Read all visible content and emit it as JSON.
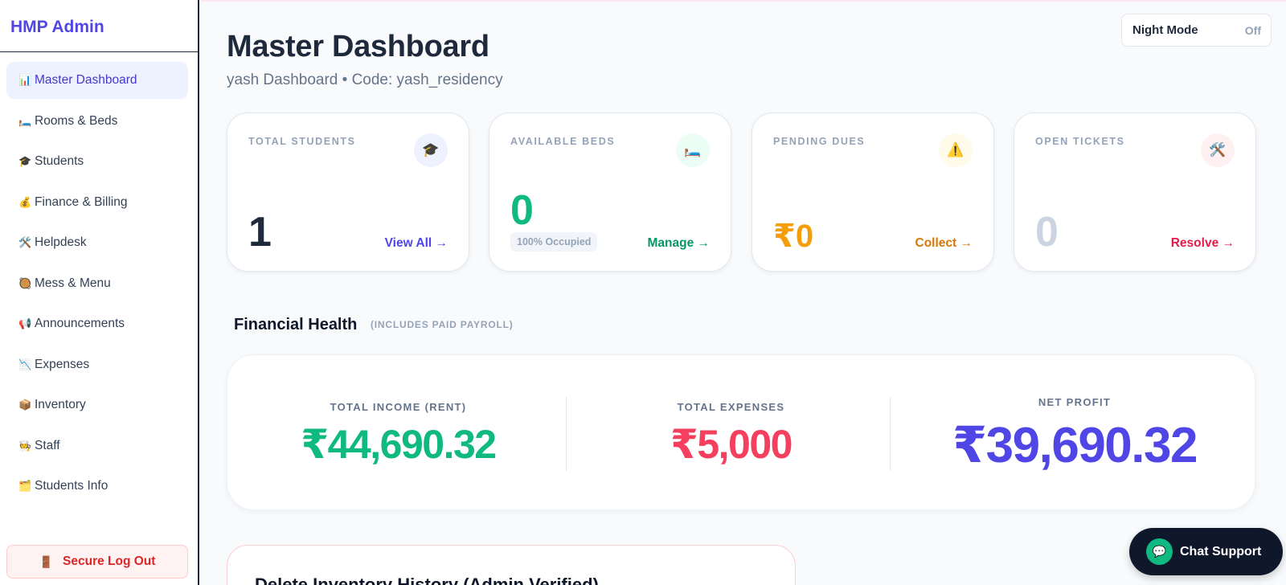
{
  "brand": {
    "title": "HMP Admin"
  },
  "sidebar": {
    "items": [
      {
        "label": "Master Dashboard",
        "icon": "📊"
      },
      {
        "label": "Rooms & Beds",
        "icon": "🛏️"
      },
      {
        "label": "Students",
        "icon": "🎓"
      },
      {
        "label": "Finance & Billing",
        "icon": "💰"
      },
      {
        "label": "Helpdesk",
        "icon": "🛠️"
      },
      {
        "label": "Mess & Menu",
        "icon": "🥘"
      },
      {
        "label": "Announcements",
        "icon": "📢"
      },
      {
        "label": "Expenses",
        "icon": "📉"
      },
      {
        "label": "Inventory",
        "icon": "📦"
      },
      {
        "label": "Staff",
        "icon": "🧑‍🍳"
      },
      {
        "label": "Students Info",
        "icon": "🗂️"
      }
    ],
    "logout": {
      "label": "Secure Log Out",
      "icon": "🚪"
    }
  },
  "header": {
    "night_mode_label": "Night Mode",
    "night_mode_state": "Off",
    "title": "Master Dashboard",
    "subtitle": "yash Dashboard • Code: yash_residency"
  },
  "stats": [
    {
      "label": "TOTAL STUDENTS",
      "value": "1",
      "icon": "🎓",
      "link": "View All →",
      "color": "#1e293b",
      "link_color": "#4f46e5",
      "icon_bg": "#eef2ff"
    },
    {
      "label": "AVAILABLE BEDS",
      "value": "0",
      "icon": "🛏️",
      "link": "Manage →",
      "color": "#10b981",
      "link_color": "#059669",
      "icon_bg": "#ecfdf5",
      "badge": "100% Occupied"
    },
    {
      "label": "PENDING DUES",
      "value": "₹0",
      "icon": "⚠️",
      "link": "Collect →",
      "color": "#f59e0b",
      "link_color": "#d97706",
      "icon_bg": "#fffbeb"
    },
    {
      "label": "OPEN TICKETS",
      "value": "0",
      "icon": "🛠️",
      "link": "Resolve →",
      "color": "#cbd5e1",
      "link_color": "#e11d48",
      "icon_bg": "#fff1f2"
    }
  ],
  "financial": {
    "title": "Financial Health",
    "note": "(INCLUDES PAID PAYROLL)",
    "income": {
      "label": "TOTAL INCOME (RENT)",
      "value": "₹44,690.32",
      "color": "#10b981"
    },
    "expenses": {
      "label": "TOTAL EXPENSES",
      "value": "₹5,000",
      "color": "#f43f5e"
    },
    "profit": {
      "label": "NET PROFIT",
      "value": "₹39,690.32",
      "color": "#4f46e5"
    }
  },
  "history": {
    "title": "Delete Inventory History (Admin Verified)"
  },
  "chat": {
    "label": "Chat Support"
  }
}
